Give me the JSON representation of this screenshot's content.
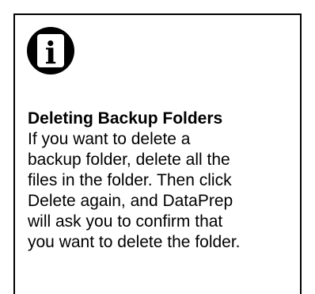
{
  "note": {
    "icon": "info-icon",
    "icon_glyph": "i",
    "title": "Deleting Backup Folders",
    "body_lines": [
      "If you want to delete a",
      "backup folder, delete all the",
      "files in the folder. Then click",
      "Delete again, and DataPrep",
      "will ask you to confirm that",
      "you want to delete the folder."
    ]
  }
}
